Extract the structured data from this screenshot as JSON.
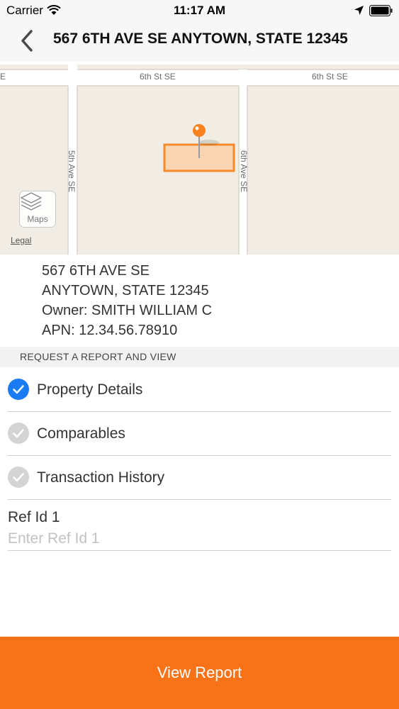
{
  "status_bar": {
    "carrier": "Carrier",
    "time": "11:17 AM",
    "icons": [
      "wifi-icon",
      "location-arrow-icon",
      "battery-icon"
    ]
  },
  "nav": {
    "title": "567 6TH AVE SE ANYTOWN, STATE 12345",
    "back_icon": "chevron-left-icon"
  },
  "map": {
    "streets": {
      "top_left": "6th St SE",
      "top_right": "6th St SE",
      "left_vertical": "5th Ave SE",
      "right_vertical": "6th Ave SE",
      "edge_fragment": "E"
    },
    "maps_button_label": "Maps",
    "legal_label": "Legal",
    "pin_color": "#f7821f",
    "parcel_fill": "#f9d4b3",
    "parcel_stroke": "#f58a2a"
  },
  "property": {
    "address_line1": "567 6TH AVE SE",
    "address_line2": "ANYTOWN, STATE 12345",
    "owner": "Owner: SMITH WILLIAM C",
    "apn": "APN: 12.34.56.78910"
  },
  "section": {
    "header": "REQUEST A REPORT AND VIEW"
  },
  "options": [
    {
      "label": "Property Details",
      "checked": true
    },
    {
      "label": "Comparables",
      "checked": false
    },
    {
      "label": "Transaction History",
      "checked": false
    }
  ],
  "ref": {
    "label": "Ref Id 1",
    "placeholder": "Enter Ref Id 1",
    "value": ""
  },
  "footer": {
    "button_label": "View Report",
    "button_color": "#f87218"
  },
  "colors": {
    "accent_blue": "#1a7cf5",
    "unchecked_gray": "#d4d4d4"
  }
}
